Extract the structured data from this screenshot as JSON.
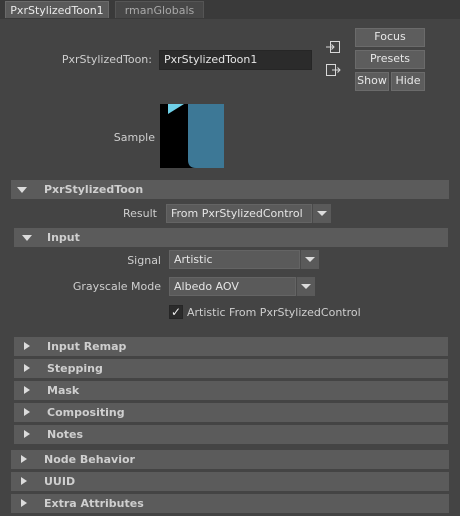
{
  "tabs": [
    {
      "label": "PxrStylizedToon1",
      "active": true
    },
    {
      "label": "rmanGlobals",
      "active": false
    }
  ],
  "node": {
    "name_label": "PxrStylizedToon:",
    "name_value": "PxrStylizedToon1",
    "sample_label": "Sample"
  },
  "buttons": {
    "focus": "Focus",
    "presets": "Presets",
    "show": "Show",
    "hide": "Hide"
  },
  "icons": {
    "input_connection": "input-connection-icon",
    "output_connection": "output-connection-icon"
  },
  "sections": {
    "main": "PxrStylizedToon",
    "input": "Input",
    "input_remap": "Input Remap",
    "stepping": "Stepping",
    "mask": "Mask",
    "compositing": "Compositing",
    "notes": "Notes",
    "node_behavior": "Node Behavior",
    "uuid": "UUID",
    "extra_attributes": "Extra Attributes"
  },
  "fields": {
    "result_label": "Result",
    "result_value": "From PxrStylizedControl",
    "signal_label": "Signal",
    "signal_value": "Artistic",
    "grayscale_label": "Grayscale Mode",
    "grayscale_value": "Albedo AOV",
    "artistic_checkbox_label": "Artistic From PxrStylizedControl",
    "artistic_checked": true
  },
  "colors": {
    "swatch_bg": "#000000",
    "swatch_blue": "#3d7896",
    "swatch_cyan": "#6fd0e8",
    "panel_bg": "#444444",
    "section_bg": "#5b5b5b"
  }
}
